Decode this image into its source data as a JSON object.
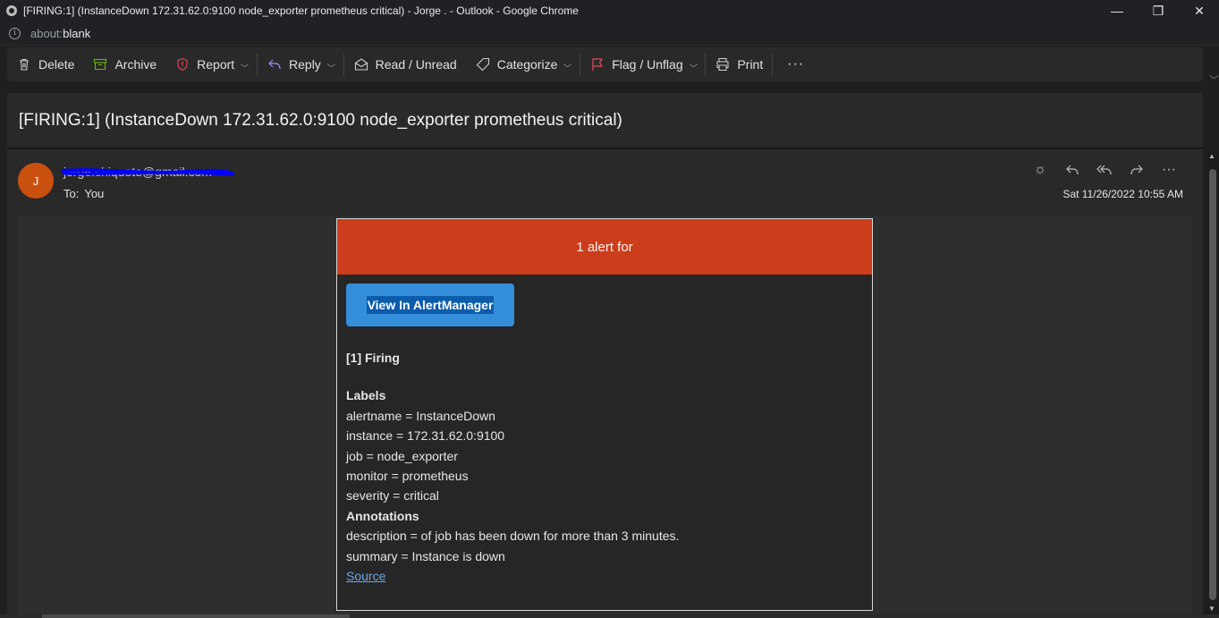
{
  "window": {
    "title": "[FIRING:1] (InstanceDown 172.31.62.0:9100 node_exporter prometheus critical) - Jorge . - Outlook - Google Chrome",
    "controls": {
      "minimize": "—",
      "restore": "❐",
      "close": "✕"
    }
  },
  "urlbar": {
    "scheme": "about:",
    "page": "blank"
  },
  "toolbar": {
    "delete": "Delete",
    "archive": "Archive",
    "report": "Report",
    "reply": "Reply",
    "read_unread": "Read / Unread",
    "categorize": "Categorize",
    "flag": "Flag / Unflag",
    "print": "Print",
    "more": "···"
  },
  "message": {
    "subject": "[FIRING:1] (InstanceDown 172.31.62.0:9100 node_exporter prometheus critical)",
    "avatar_initial": "J",
    "sender": "jorge.chiquete@gmail.com",
    "to_label": "To:",
    "to_value": "You",
    "datetime": "Sat 11/26/2022 10:55 AM"
  },
  "alert": {
    "header": "1 alert for",
    "button": "View In AlertManager",
    "firing": "[1] Firing",
    "labels_title": "Labels",
    "labels": [
      "alertname = InstanceDown",
      "instance = 172.31.62.0:9100",
      "job = node_exporter",
      "monitor = prometheus",
      "severity = critical"
    ],
    "annotations_title": "Annotations",
    "annotations": [
      "description = of job has been down for more than 3 minutes.",
      "summary = Instance is down"
    ],
    "source_link": "Source"
  },
  "colors": {
    "alert_header": "#cc3d1b",
    "button": "#348eda",
    "avatar": "#ca5010",
    "flag_icon": "#e74856",
    "archive_icon": "#6bb700",
    "report_icon": "#e74856",
    "reply_icon": "#a78bfa",
    "redaction": "#0000ff"
  }
}
